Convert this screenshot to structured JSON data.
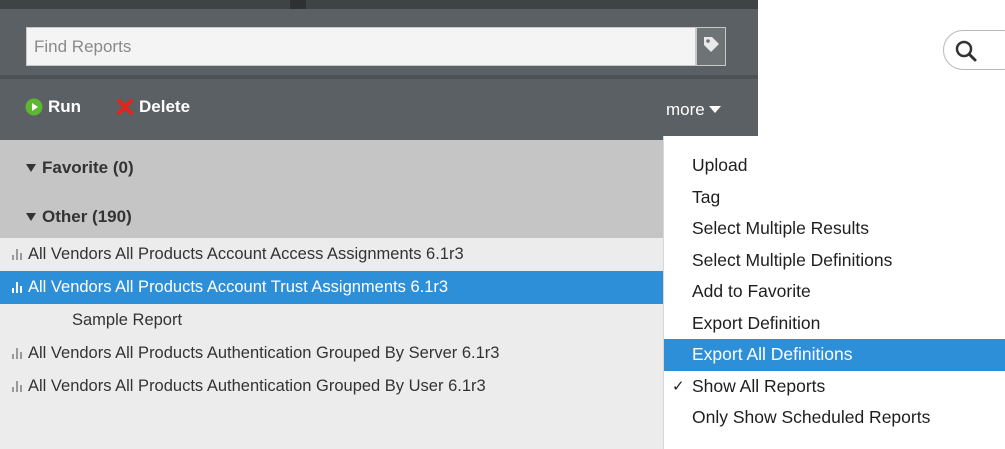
{
  "search": {
    "placeholder": "Find Reports",
    "value": ""
  },
  "toolbar": {
    "run_label": "Run",
    "delete_label": "Delete",
    "more_label": "more"
  },
  "groups": [
    {
      "label": "Favorite (0)",
      "expanded": true
    },
    {
      "label": "Other (190)",
      "expanded": true
    }
  ],
  "reports": [
    {
      "label": "All Vendors All Products Account Access Assignments 6.1r3",
      "selected": false,
      "icon": "bar-chart-icon"
    },
    {
      "label": "All Vendors All Products Account Trust Assignments 6.1r3",
      "selected": true,
      "icon": "bar-chart-icon"
    },
    {
      "label": "Sample Report",
      "selected": false,
      "icon": null
    },
    {
      "label": "All Vendors All Products Authentication Grouped By Server 6.1r3",
      "selected": false,
      "icon": "bar-chart-icon"
    },
    {
      "label": "All Vendors All Products Authentication Grouped By User 6.1r3",
      "selected": false,
      "icon": "bar-chart-icon"
    }
  ],
  "more_menu": {
    "items": [
      {
        "label": "Upload"
      },
      {
        "label": "Tag"
      },
      {
        "label": "Select Multiple Results"
      },
      {
        "label": "Select Multiple Definitions"
      },
      {
        "label": "Add to Favorite"
      },
      {
        "label": "Export Definition"
      },
      {
        "label": "Export All Definitions",
        "highlighted": true
      },
      {
        "label": "Show All Reports",
        "checked": true
      },
      {
        "label": "Only Show Scheduled Reports"
      }
    ]
  },
  "colors": {
    "panel_dark": "#5b6064",
    "group_header": "#c5c5c5",
    "row_bg": "#ececec",
    "selection": "#2e8fd9",
    "run_green": "#5cb82e",
    "delete_red": "#e0261b"
  }
}
